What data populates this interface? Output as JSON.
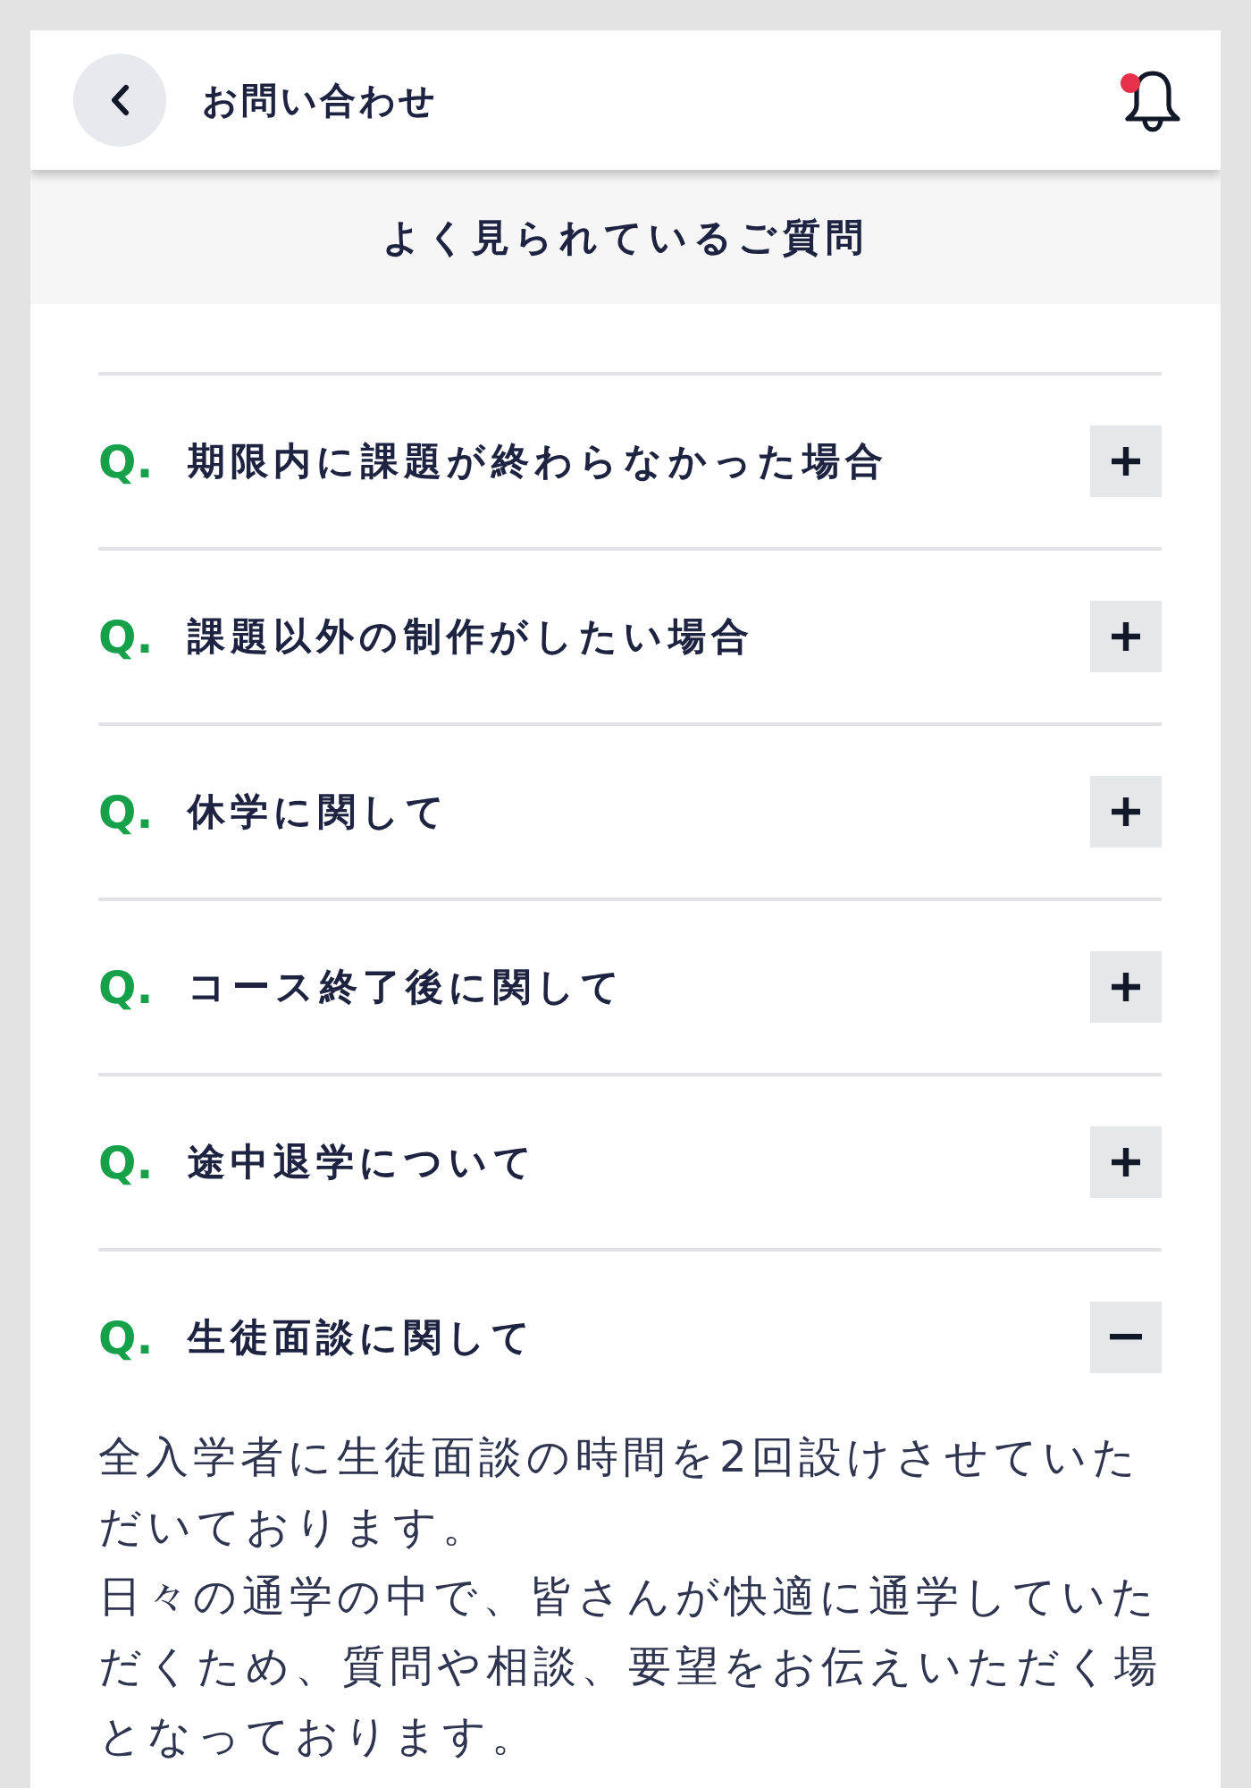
{
  "header": {
    "title": "お問い合わせ",
    "has_notification": true
  },
  "section": {
    "title": "よく見られているご質問"
  },
  "faq": [
    {
      "marker": "Q.",
      "question": "期限内に課題が終わらなかった場合",
      "expanded": false
    },
    {
      "marker": "Q.",
      "question": "課題以外の制作がしたい場合",
      "expanded": false
    },
    {
      "marker": "Q.",
      "question": "休学に関して",
      "expanded": false
    },
    {
      "marker": "Q.",
      "question": "コース終了後に関して",
      "expanded": false
    },
    {
      "marker": "Q.",
      "question": "途中退学について",
      "expanded": false
    },
    {
      "marker": "Q.",
      "question": "生徒面談に関して",
      "expanded": true,
      "answer": [
        "全入学者に生徒面談の時間を2回設けさせていただいております。",
        "日々の通学の中で、皆さんが快適に通学していただくため、質問や相談、要望をお伝えいただく場となっております。"
      ]
    }
  ]
}
